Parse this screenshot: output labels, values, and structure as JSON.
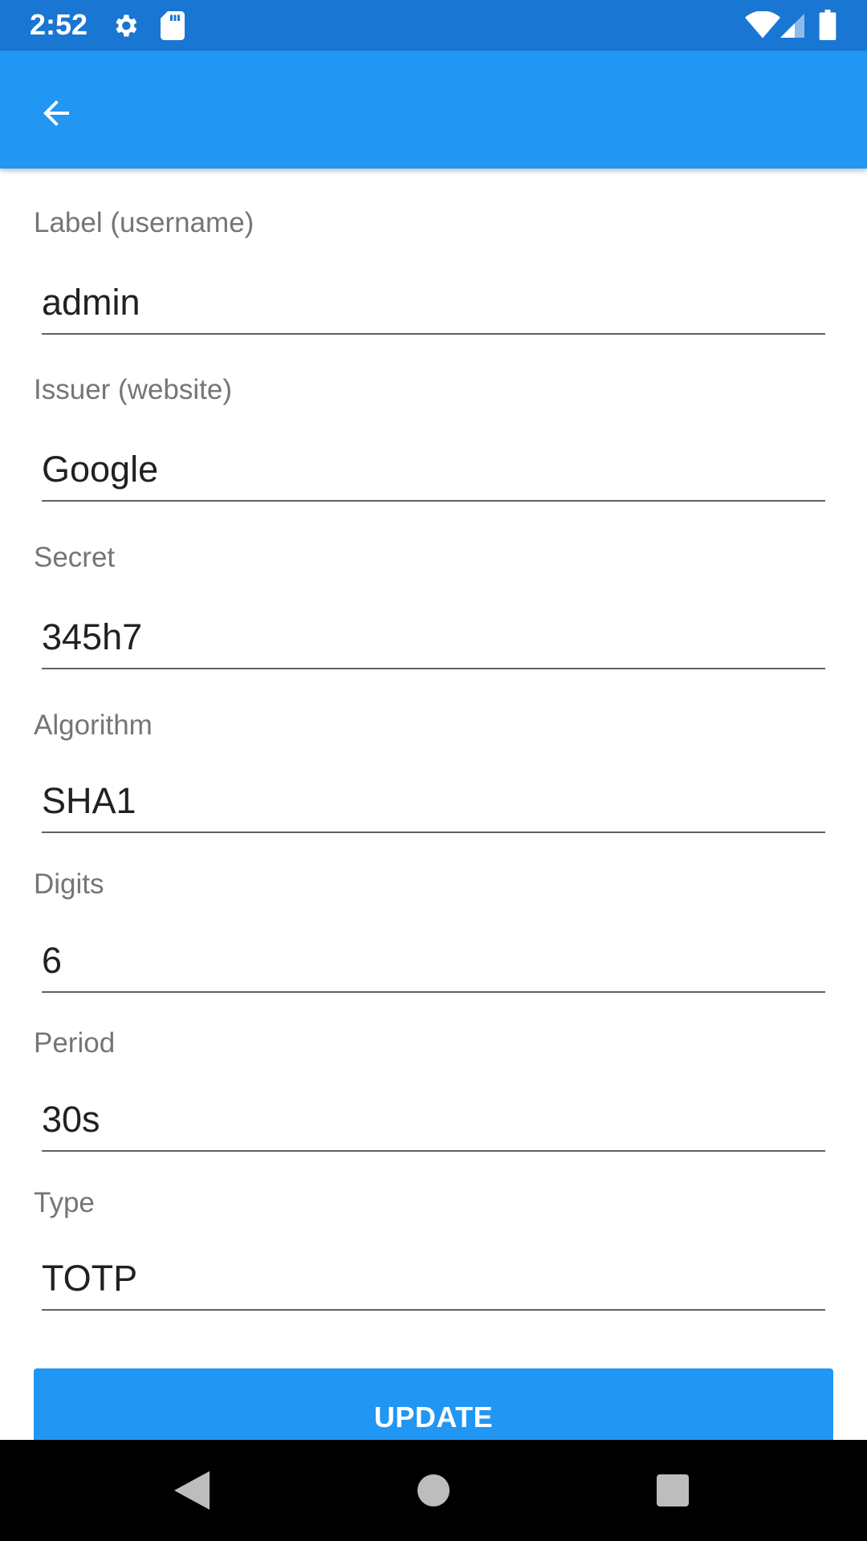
{
  "status_bar": {
    "time": "2:52",
    "icons": [
      "settings-icon",
      "sd-card-icon",
      "wifi-icon",
      "signal-icon",
      "battery-icon"
    ],
    "color": "#1976D2"
  },
  "app_bar": {
    "color": "#2196F3",
    "back_icon": "arrow-back-icon"
  },
  "form": {
    "fields": [
      {
        "label": "Label (username)",
        "value": "admin"
      },
      {
        "label": "Issuer (website)",
        "value": "Google"
      },
      {
        "label": "Secret",
        "value": "345h7"
      },
      {
        "label": "Algorithm",
        "value": "SHA1"
      },
      {
        "label": "Digits",
        "value": "6"
      },
      {
        "label": "Period",
        "value": "30s"
      },
      {
        "label": "Type",
        "value": "TOTP"
      }
    ],
    "update_label": "UPDATE"
  },
  "nav_bar": {
    "icons": [
      "back-triangle-icon",
      "home-circle-icon",
      "recents-square-icon"
    ]
  }
}
